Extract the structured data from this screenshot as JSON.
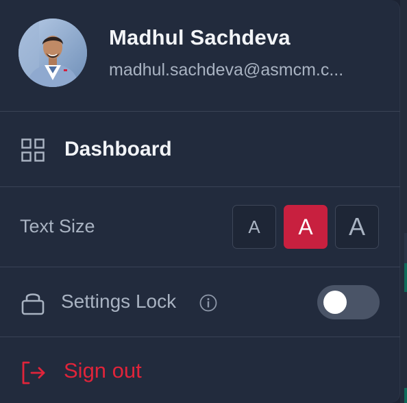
{
  "user": {
    "name": "Madhul Sachdeva",
    "email": "madhul.sachdeva@asmcm.c..."
  },
  "menu": {
    "dashboard_label": "Dashboard",
    "text_size_label": "Text Size",
    "text_size_options": [
      "A",
      "A",
      "A"
    ],
    "text_size_selected_index": 1,
    "settings_lock_label": "Settings Lock",
    "settings_lock_on": false,
    "sign_out_label": "Sign out"
  },
  "colors": {
    "background": "#222b3d",
    "accent": "#c8203f",
    "danger": "#e0243a"
  },
  "icons": [
    "avatar",
    "dashboard-grid-icon",
    "lock-icon",
    "info-icon",
    "sign-out-icon"
  ]
}
